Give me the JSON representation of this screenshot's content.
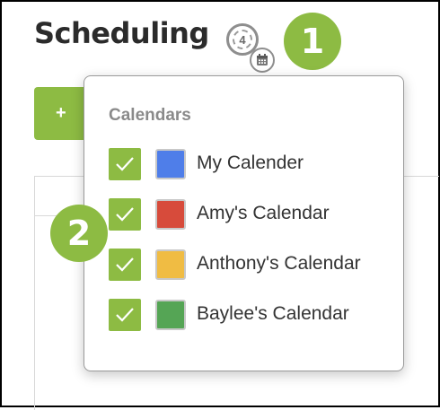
{
  "header": {
    "title": "Scheduling",
    "calendar_count": "4"
  },
  "toolbar": {
    "add_label": "+"
  },
  "callouts": [
    "1",
    "2"
  ],
  "calendars_popover": {
    "heading": "Calendars",
    "items": [
      {
        "label": "My Calender",
        "color": "#4f7ee9",
        "checked": true
      },
      {
        "label": "Amy's Calendar",
        "color": "#d74b3b",
        "checked": true
      },
      {
        "label": "Anthony's Calendar",
        "color": "#f0bc43",
        "checked": true
      },
      {
        "label": "Baylee's Calendar",
        "color": "#55a555",
        "checked": true
      }
    ]
  },
  "colors": {
    "accent": "#8dbb43",
    "title_text": "#2b2b2b",
    "muted_text": "#8a8a8a"
  }
}
